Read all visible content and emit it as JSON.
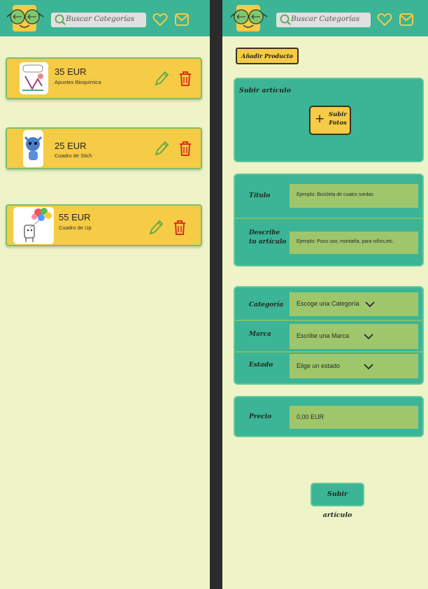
{
  "search": {
    "placeholder": "Buscar Categorías"
  },
  "icons": {
    "logo": "sunglasses-smiley-logo",
    "search": "magnifier-icon",
    "favorites": "heart-icon",
    "messages": "mail-icon",
    "edit": "pencil-icon",
    "delete": "trash-icon",
    "add": "plus-icon",
    "dropdown": "chevron-down-icon"
  },
  "colors": {
    "teal": "#3cb496",
    "yellow": "#f6cb45",
    "green_field": "#9fc66b",
    "background": "#eef4c8",
    "delete_red": "#d9301c"
  },
  "products": [
    {
      "price": "35 EUR",
      "name": "Apuntes Bioquímica"
    },
    {
      "price": "25 EUR",
      "name": "Cuadro de Stich"
    },
    {
      "price": "55 EUR",
      "name": "Cuadro de Up"
    }
  ],
  "form": {
    "add_product_label": "Añadir Producto",
    "upload_section_title": "Subir artículo",
    "upload_photos_label": "Subir Fotos",
    "title_label": "Título",
    "title_placeholder": "Ejemplo: Bicicleta de cuatro ruedas",
    "describe_label_line1": "Describe",
    "describe_label_line2": "tu artículo",
    "describe_placeholder": "Ejemplo: Poco uso, montaña, para niños,etc.",
    "category_label": "Categoría",
    "category_value": "Escoge una Categoría",
    "brand_label": "Marca",
    "brand_value": "Escribe una Marca",
    "state_label": "Estado",
    "state_value": "Elige un estado",
    "price_label": "Precio",
    "price_value": "0,00 EUR",
    "submit_label": "Subir artículo"
  }
}
